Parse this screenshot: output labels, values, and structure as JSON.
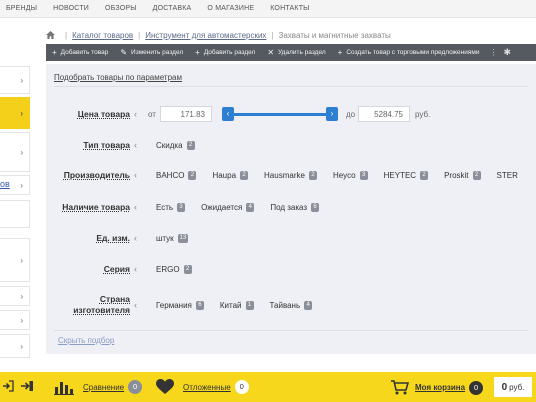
{
  "topnav": [
    "БРЕНДЫ",
    "НОВОСТИ",
    "ОБЗОРЫ",
    "ДОСТАВКА",
    "О МАГАЗИНЕ",
    "КОНТАКТЫ"
  ],
  "breadcrumb": {
    "items": [
      "Каталог товаров",
      "Инструмент для автомастерских",
      "Захваты и магнитные захваты"
    ]
  },
  "toolbar": {
    "add_product": "Добавить товар",
    "edit_section": "Изменить раздел",
    "add_section": "Добавить раздел",
    "delete_section": "Удалить раздел",
    "create_with_offers": "Создать товар с торговыми предложениями"
  },
  "sidebar": {
    "partial_link": "ов"
  },
  "filters": {
    "title_link": "Подобрать товары по параметрам",
    "price": {
      "label": "Цена товара",
      "from_label": "от",
      "from_value": "171.83",
      "to_label": "до",
      "to_value": "5284.75",
      "currency": "руб."
    },
    "rows": [
      {
        "label": "Тип товара",
        "values": [
          {
            "name": "Скидка",
            "count": "2"
          }
        ]
      },
      {
        "label": "Производитель",
        "values": [
          {
            "name": "BAHCO",
            "count": "2"
          },
          {
            "name": "Haupa",
            "count": "2"
          },
          {
            "name": "Hausmarke",
            "count": "2"
          },
          {
            "name": "Heyco",
            "count": "3"
          },
          {
            "name": "HEYTEC",
            "count": "2"
          },
          {
            "name": "Proskit",
            "count": "2"
          },
          {
            "name": "STER",
            "count": ""
          }
        ]
      },
      {
        "label": "Наличие товара",
        "values": [
          {
            "name": "Есть",
            "count": "3"
          },
          {
            "name": "Ожидается",
            "count": "4"
          },
          {
            "name": "Под заказ",
            "count": "6"
          }
        ]
      },
      {
        "label": "Ед. изм.",
        "values": [
          {
            "name": "штук",
            "count": "13"
          }
        ]
      },
      {
        "label": "Серия",
        "values": [
          {
            "name": "ERGO",
            "count": "2"
          }
        ]
      },
      {
        "label": "Страна изготовителя",
        "values": [
          {
            "name": "Германия",
            "count": "6"
          },
          {
            "name": "Китай",
            "count": "1"
          },
          {
            "name": "Тайвань",
            "count": "4"
          }
        ]
      }
    ],
    "hide_link": "Скрыть подбор"
  },
  "bottombar": {
    "compare_label": "Сравнение",
    "compare_count": "0",
    "deferred_label": "Отложенные",
    "deferred_count": "0",
    "cart_label": "Моя корзина",
    "cart_count": "0",
    "cart_sum": "0",
    "cart_currency": "руб."
  },
  "colors": {
    "accent_yellow": "#f7d71c",
    "toolbar": "#555a61",
    "slider": "#2d7fd4"
  },
  "icons": [
    "home-icon",
    "plus-icon",
    "pencil-icon",
    "close-icon",
    "gear-icon",
    "login-icon",
    "chart-icon",
    "heart-icon",
    "cart-icon",
    "chevron-left-icon",
    "chevron-right-icon"
  ]
}
